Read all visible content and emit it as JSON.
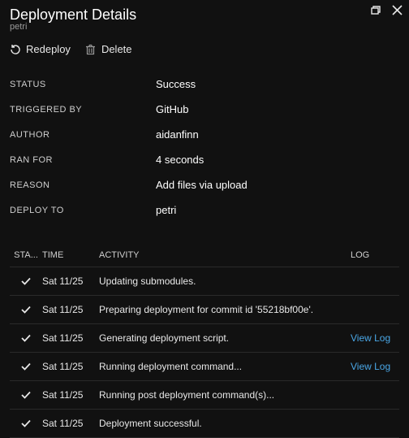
{
  "header": {
    "title": "Deployment Details",
    "subtitle": "petri"
  },
  "toolbar": {
    "redeploy_label": "Redeploy",
    "delete_label": "Delete"
  },
  "details": {
    "status_label": "STATUS",
    "status_value": "Success",
    "triggered_label": "TRIGGERED BY",
    "triggered_value": "GitHub",
    "author_label": "AUTHOR",
    "author_value": "aidanfinn",
    "ranfor_label": "RAN FOR",
    "ranfor_value": "4 seconds",
    "reason_label": "REASON",
    "reason_value": "Add files via upload",
    "deployto_label": "DEPLOY TO",
    "deployto_value": "petri"
  },
  "table": {
    "headers": {
      "status": "STA...",
      "time": "TIME",
      "activity": "ACTIVITY",
      "log": "LOG"
    },
    "rows": [
      {
        "time": "Sat 11/25",
        "activity": "Updating submodules.",
        "log": ""
      },
      {
        "time": "Sat 11/25",
        "activity": "Preparing deployment for commit id '55218bf00e'.",
        "log": ""
      },
      {
        "time": "Sat 11/25",
        "activity": "Generating deployment script.",
        "log": "View Log"
      },
      {
        "time": "Sat 11/25",
        "activity": "Running deployment command...",
        "log": "View Log"
      },
      {
        "time": "Sat 11/25",
        "activity": "Running post deployment command(s)...",
        "log": ""
      },
      {
        "time": "Sat 11/25",
        "activity": "Deployment successful.",
        "log": ""
      }
    ]
  }
}
